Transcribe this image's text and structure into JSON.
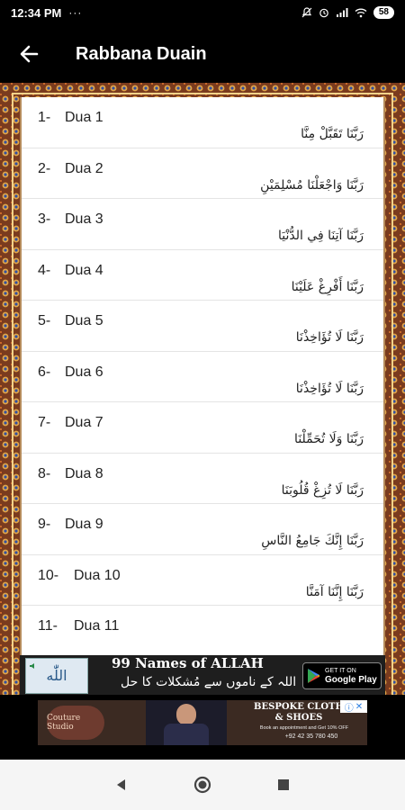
{
  "status": {
    "time": "12:34 PM",
    "dots": "···",
    "battery": "58"
  },
  "appbar": {
    "title": "Rabbana Duain"
  },
  "duas": [
    {
      "num": "1-",
      "label": "Dua 1",
      "arabic": "رَبَّنَا تَقَبَّلْ مِنَّا"
    },
    {
      "num": "2-",
      "label": "Dua 2",
      "arabic": "رَبَّنَا وَاجْعَلْنَا مُسْلِمَيْنِ"
    },
    {
      "num": "3-",
      "label": "Dua 3",
      "arabic": "رَبَّنَا آتِنَا فِي الدُّنْيَا"
    },
    {
      "num": "4-",
      "label": "Dua 4",
      "arabic": "رَبَّنَا أَفْرِغْ عَلَيْنَا"
    },
    {
      "num": "5-",
      "label": "Dua 5",
      "arabic": "رَبَّنَا لَا تُؤَاخِذْنَا"
    },
    {
      "num": "6-",
      "label": "Dua 6",
      "arabic": "رَبَّنَا لَا تُؤَاخِذْنَا"
    },
    {
      "num": "7-",
      "label": "Dua 7",
      "arabic": "رَبَّنَا وَلَا تُحَمِّلْنَا"
    },
    {
      "num": "8-",
      "label": "Dua 8",
      "arabic": "رَبَّنَا لَا تُزِغْ قُلُوبَنَا"
    },
    {
      "num": "9-",
      "label": "Dua 9",
      "arabic": "رَبَّنَا إِنَّكَ جَامِعُ النَّاسِ"
    },
    {
      "num": "10-",
      "label": "Dua 10",
      "arabic": "رَبَّنَا إِنَّنَا آمَنَّا"
    },
    {
      "num": "11-",
      "label": "Dua 11",
      "arabic": ""
    }
  ],
  "ad1": {
    "headline": "99 Names of ALLAH",
    "sub": "اللہ کے ناموں سے مُشکلات کا حل",
    "gp_small": "GET IT ON",
    "gp_big": "Google Play"
  },
  "ad2": {
    "brand": "Couture Studio",
    "line1": "BESPOKE CLOTH",
    "line2": "& SHOES",
    "line3": "Book an appointment and Get 10% OFF",
    "phone": "+92 42 35 780 450"
  },
  "colors": {
    "frame": "#7a3b1e",
    "appbar": "#000000"
  }
}
